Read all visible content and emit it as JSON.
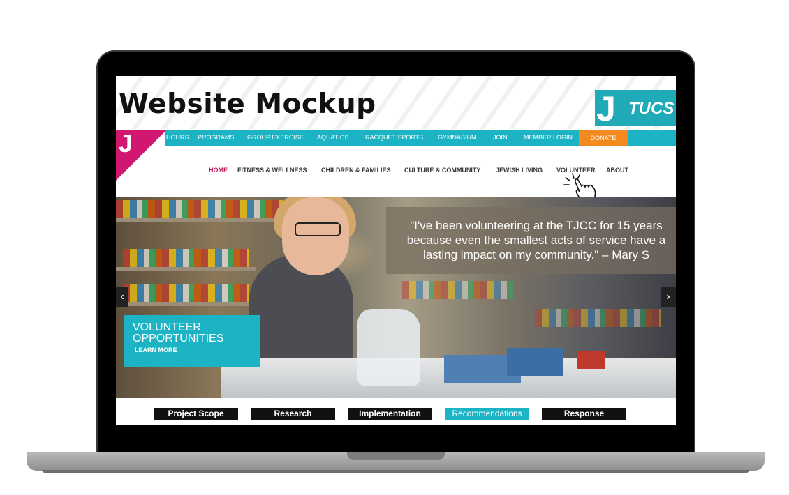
{
  "mockup": {
    "title": "Website Mockup"
  },
  "brand": {
    "logo_letter": "J",
    "logo_text": "TUCS"
  },
  "utility_nav": [
    "HOURS",
    "PROGRAMS",
    "GROUP EXERCISE",
    "AQUATICS",
    "RACQUET SPORTS",
    "GYMNASIUM",
    "JOIN",
    "MEMBER LOGIN"
  ],
  "donate_label": "DONATE",
  "main_nav": [
    "HOME",
    "FITNESS & WELLNESS",
    "CHILDREN & FAMILIES",
    "CULTURE & COMMUNITY",
    "JEWISH LIVING",
    "VOLUNTEER",
    "ABOUT"
  ],
  "hero": {
    "quote_lines": [
      "\"I've been volunteering at the TJCC for 15 years",
      "because even the smallest acts of service have a",
      "lasting impact on my community.\" – Mary S"
    ],
    "prev_glyph": "‹",
    "next_glyph": "›",
    "cta_title": "VOLUNTEER OPPORTUNITIES",
    "cta_link": "LEARN MORE"
  },
  "tabs": [
    "Project Scope",
    "Research",
    "Implementation",
    "Recommendations",
    "Response"
  ],
  "colors": {
    "teal": "#1cb4c4",
    "magenta": "#d1176f",
    "orange": "#f28a1d",
    "brand_teal": "#20a9b7"
  },
  "icons": [
    "pointer-hand-icon",
    "chevron-left-icon",
    "chevron-right-icon"
  ]
}
